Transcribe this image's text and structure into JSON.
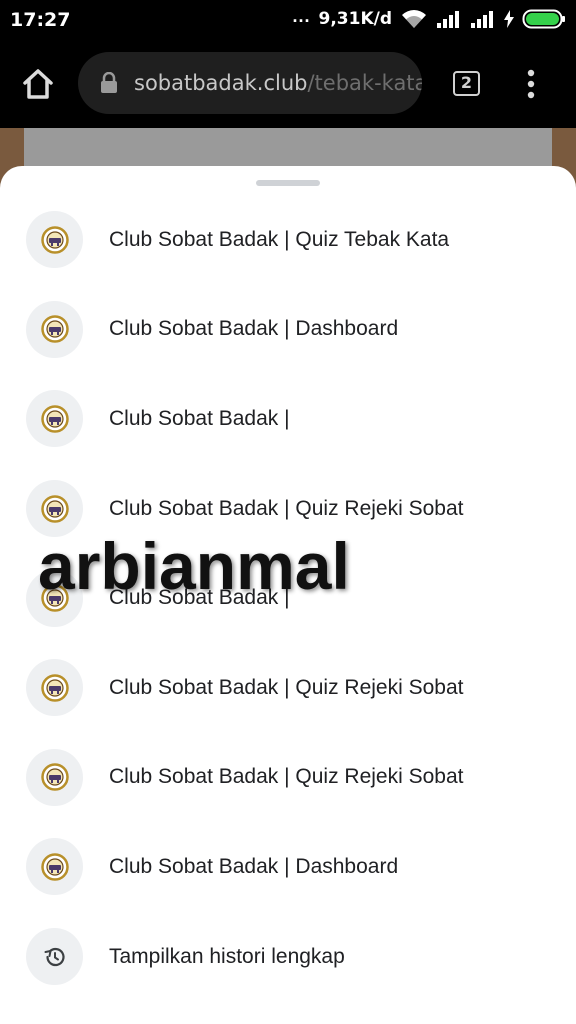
{
  "status_bar": {
    "time": "17:27",
    "dots": "...",
    "speed": "9,31K/d"
  },
  "browser": {
    "url_domain": "sobatbadak.club",
    "url_path": "/tebak-kata",
    "tab_count": "2"
  },
  "history": {
    "items": [
      {
        "label": "Club Sobat Badak | Quiz Tebak Kata",
        "icon": "site-favicon"
      },
      {
        "label": "Club Sobat Badak | Dashboard",
        "icon": "site-favicon"
      },
      {
        "label": "Club Sobat Badak |",
        "icon": "site-favicon"
      },
      {
        "label": "Club Sobat Badak | Quiz Rejeki Sobat",
        "icon": "site-favicon"
      },
      {
        "label": "Club Sobat Badak |",
        "icon": "site-favicon"
      },
      {
        "label": "Club Sobat Badak | Quiz Rejeki Sobat",
        "icon": "site-favicon"
      },
      {
        "label": "Club Sobat Badak | Quiz Rejeki Sobat",
        "icon": "site-favicon"
      },
      {
        "label": "Club Sobat Badak | Dashboard",
        "icon": "site-favicon"
      }
    ],
    "full_history_label": "Tampilkan histori lengkap"
  },
  "watermark": "arbianmal",
  "colors": {
    "sheet_bg": "#ffffff",
    "favicon_bg": "#eef0f2",
    "text": "#202124",
    "toolbar_bg": "#000000",
    "url_field_bg": "#1f1f1f"
  }
}
